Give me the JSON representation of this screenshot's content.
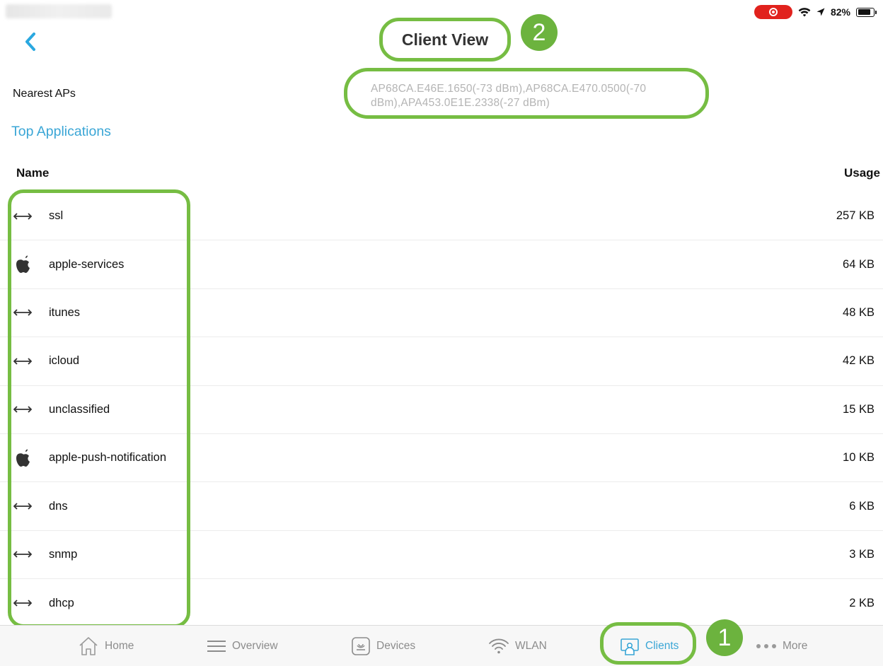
{
  "status_bar": {
    "battery_percent": "82%",
    "battery_level": 0.82,
    "record_color": "#e1221d",
    "icons": [
      "screen-record-icon",
      "wifi-icon",
      "location-arrow-icon",
      "battery-icon"
    ]
  },
  "header": {
    "title": "Client View",
    "back_icon": "chevron-left-icon"
  },
  "nearest": {
    "label": "Nearest APs",
    "value": "AP68CA.E46E.1650(-73 dBm),AP68CA.E470.0500(-70 dBm),APA453.0E1E.2338(-27 dBm)"
  },
  "section": {
    "title": "Top Applications"
  },
  "table": {
    "columns": {
      "name": "Name",
      "usage": "Usage"
    },
    "rows": [
      {
        "icon": "arrows-horizontal-icon",
        "name": "ssl",
        "usage": "257 KB"
      },
      {
        "icon": "apple-icon",
        "name": "apple-services",
        "usage": "64 KB"
      },
      {
        "icon": "arrows-horizontal-icon",
        "name": "itunes",
        "usage": "48 KB"
      },
      {
        "icon": "arrows-horizontal-icon",
        "name": "icloud",
        "usage": "42 KB"
      },
      {
        "icon": "arrows-horizontal-icon",
        "name": "unclassified",
        "usage": "15 KB"
      },
      {
        "icon": "apple-icon",
        "name": "apple-push-notification",
        "usage": "10 KB"
      },
      {
        "icon": "arrows-horizontal-icon",
        "name": "dns",
        "usage": "6 KB"
      },
      {
        "icon": "arrows-horizontal-icon",
        "name": "snmp",
        "usage": "3 KB"
      },
      {
        "icon": "arrows-horizontal-icon",
        "name": "dhcp",
        "usage": "2 KB"
      }
    ]
  },
  "tabbar": {
    "tabs": [
      {
        "label": "Home",
        "icon": "home-icon"
      },
      {
        "label": "Overview",
        "icon": "list-icon"
      },
      {
        "label": "Devices",
        "icon": "access-point-icon"
      },
      {
        "label": "WLAN",
        "icon": "wifi-icon"
      },
      {
        "label": "Clients",
        "icon": "client-icon",
        "active": true
      },
      {
        "label": "More",
        "icon": "more-dots-icon"
      }
    ]
  },
  "annotations": {
    "callout_1": "1",
    "callout_2": "2",
    "highlight_color": "#76bd43"
  },
  "colors": {
    "accent": "#3aa6d6",
    "highlight": "#76bd43",
    "callout": "#6cb33e"
  }
}
